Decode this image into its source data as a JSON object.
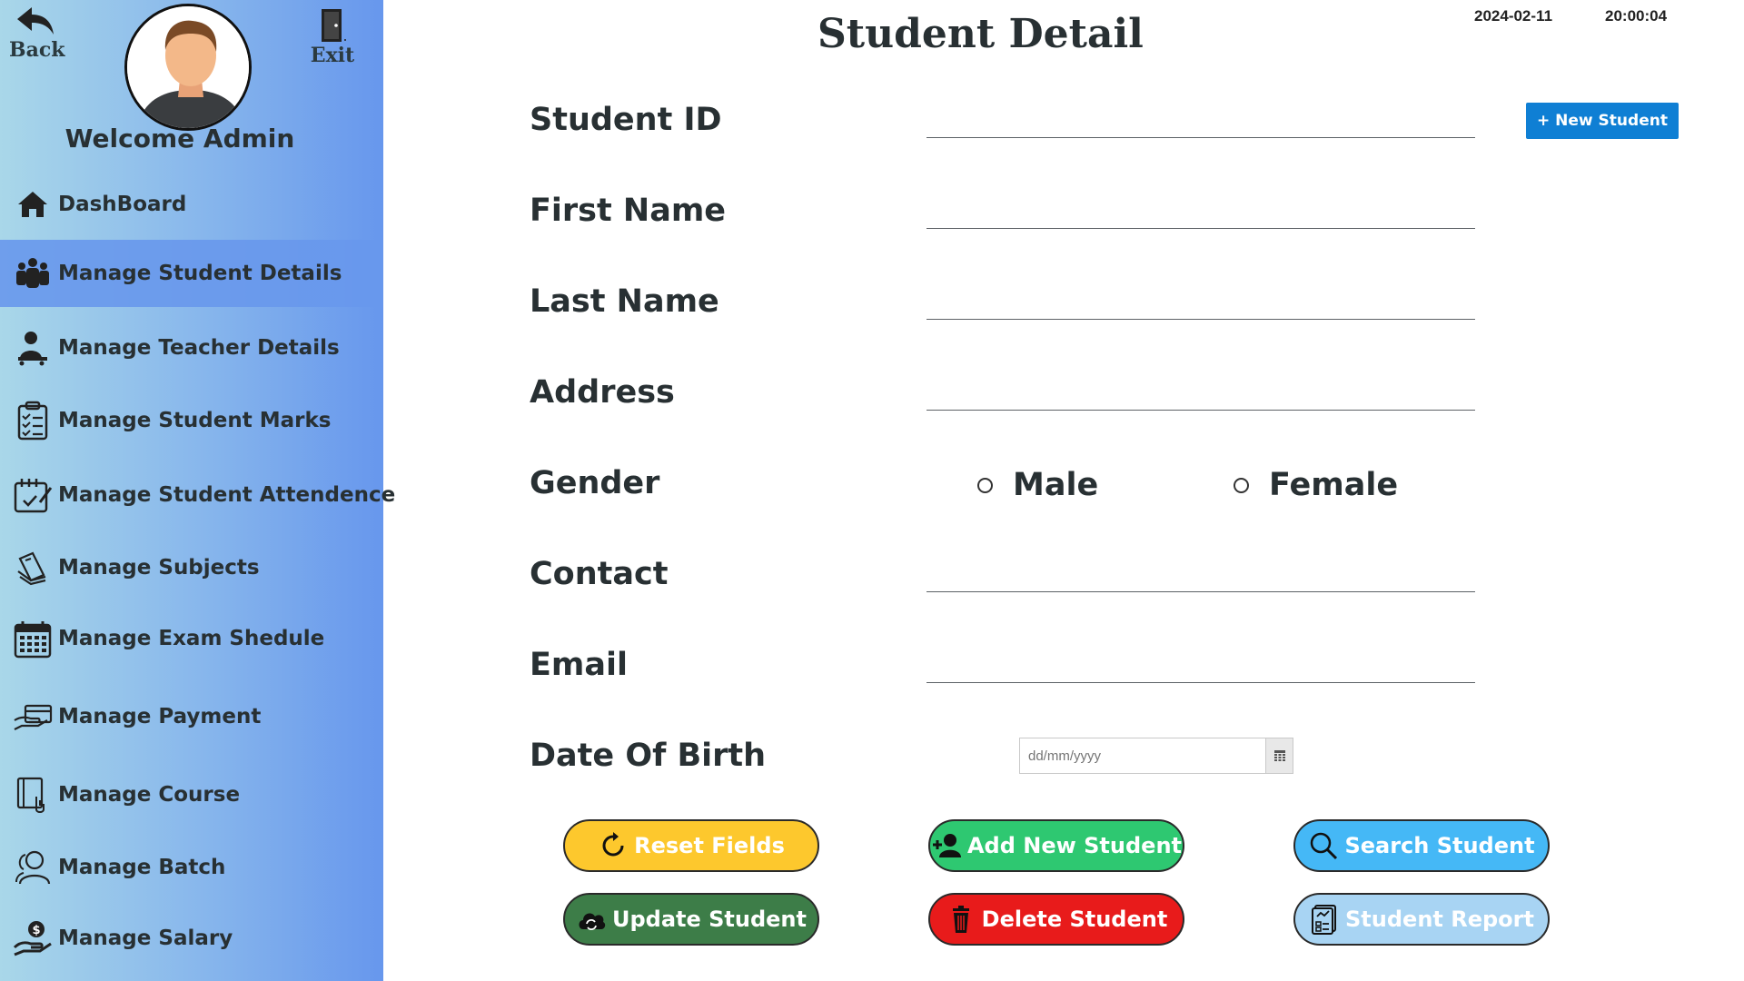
{
  "sidebar": {
    "back_label": "Back",
    "exit_label": "Exit",
    "welcome": "Welcome Admin",
    "items": [
      {
        "label": "DashBoard",
        "icon": "home-icon",
        "active": false
      },
      {
        "label": "Manage Student Details",
        "icon": "users-group-icon",
        "active": true
      },
      {
        "label": "Manage Teacher Details",
        "icon": "teacher-icon",
        "active": false
      },
      {
        "label": "Manage Student Marks",
        "icon": "clipboard-checklist-icon",
        "active": false
      },
      {
        "label": "Manage Student Attendence",
        "icon": "calendar-check-icon",
        "active": false
      },
      {
        "label": "Manage Subjects",
        "icon": "books-icon",
        "active": false
      },
      {
        "label": "Manage Exam Shedule",
        "icon": "calendar-icon",
        "active": false
      },
      {
        "label": "Manage Payment",
        "icon": "payment-hand-icon",
        "active": false
      },
      {
        "label": "Manage Course",
        "icon": "course-book-icon",
        "active": false
      },
      {
        "label": "Manage Batch",
        "icon": "users-outline-icon",
        "active": false
      },
      {
        "label": "Manage Salary",
        "icon": "salary-hand-icon",
        "active": false
      }
    ]
  },
  "header": {
    "title": "Student Detail",
    "date": "2024-02-11",
    "time": "20:00:04"
  },
  "form": {
    "new_student_label": "+ New Student",
    "student_id_label": "Student ID",
    "first_name_label": "First Name",
    "last_name_label": "Last Name",
    "address_label": "Address",
    "gender_label": "Gender",
    "gender_options": [
      "Male",
      "Female"
    ],
    "contact_label": "Contact",
    "email_label": "Email",
    "dob_label": "Date Of Birth",
    "dob_placeholder": "dd/mm/yyyy",
    "student_id_value": "",
    "first_name_value": "",
    "last_name_value": "",
    "address_value": "",
    "contact_value": "",
    "email_value": ""
  },
  "actions": {
    "reset": "Reset Fields",
    "add": "Add New Student",
    "search": "Search Student",
    "update": "Update Student",
    "delete": "Delete Student",
    "report": "Student Report"
  },
  "colors": {
    "sidebar_start": "#a9d7e9",
    "sidebar_end": "#6797ed",
    "reset": "#fdc82d",
    "add": "#2ec871",
    "search": "#45b8f6",
    "update": "#3d7d48",
    "delete": "#e81b1b",
    "report": "#a8d4f3",
    "new_student": "#0f7fd4"
  }
}
